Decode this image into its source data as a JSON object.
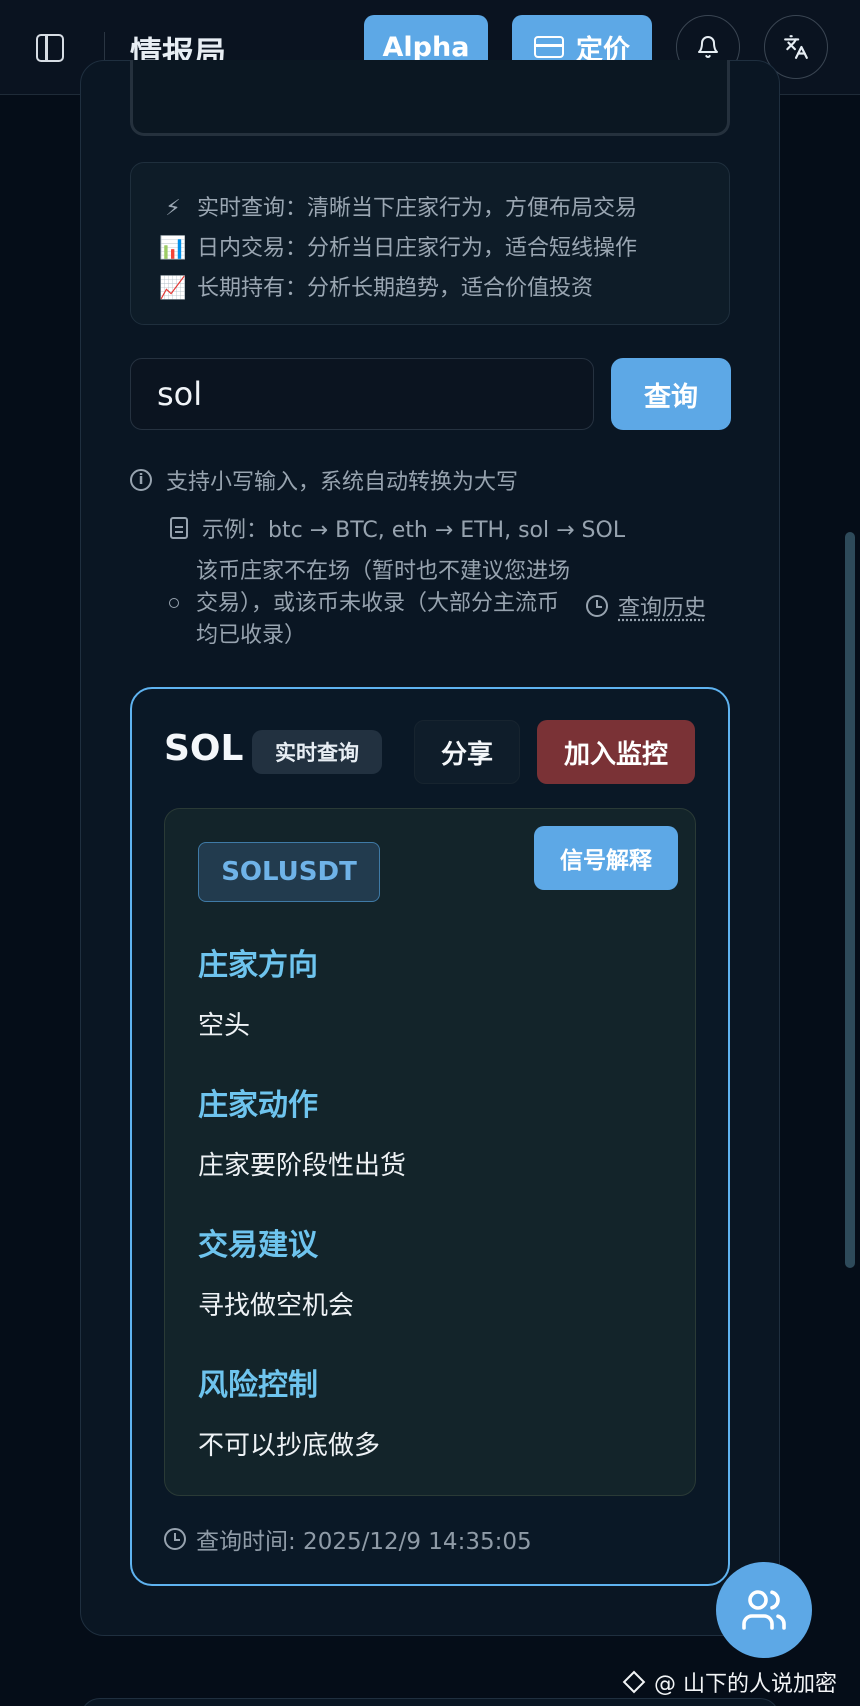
{
  "header": {
    "app_title": "情报局",
    "alpha_label": "Alpha",
    "pricing_label": "定价"
  },
  "intro": {
    "lines": [
      {
        "emoji": "⚡",
        "text": "实时查询：清晰当下庄家行为，方便布局交易"
      },
      {
        "emoji": "📊",
        "text": "日内交易：分析当日庄家行为，适合短线操作"
      },
      {
        "emoji": "📈",
        "text": "长期持有：分析长期趋势，适合价值投资"
      }
    ]
  },
  "search": {
    "value": "sol",
    "button_label": "查询"
  },
  "hints": {
    "lowercase": "支持小写输入，系统自动转换为大写",
    "example": "示例：btc → BTC, eth → ETH, sol → SOL",
    "not_listed": "该币庄家不在场（暂时也不建议您进场交易），或该币未收录（大部分主流币均已收录）",
    "history_label": "查询历史"
  },
  "result": {
    "symbol": "SOL",
    "mode_badge": "实时查询",
    "share_label": "分享",
    "monitor_label": "加入监控",
    "pair": "SOLUSDT",
    "explain_label": "信号解释",
    "sections": [
      {
        "title": "庄家方向",
        "value": "空头"
      },
      {
        "title": "庄家动作",
        "value": "庄家要阶段性出货"
      },
      {
        "title": "交易建议",
        "value": "寻找做空机会"
      },
      {
        "title": "风险控制",
        "value": "不可以抄底做多"
      }
    ],
    "query_time": "查询时间: 2025/12/9 14:35:05"
  },
  "watermark": "@ 山下的人说加密",
  "colors": {
    "accent": "#5da8e6",
    "danger": "#7a3236",
    "section_title": "#6ec4ee",
    "background": "#050d18"
  }
}
